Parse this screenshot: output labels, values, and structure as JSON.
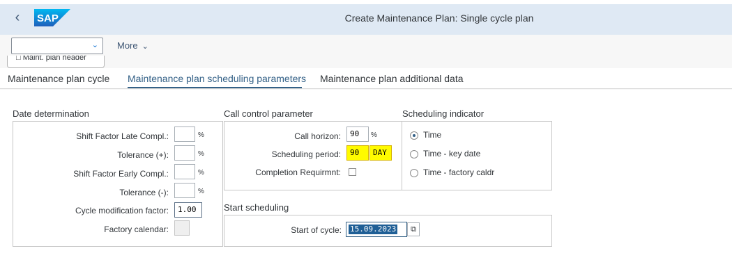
{
  "shell": {
    "back_glyph": "‹",
    "logo_text": "SAP",
    "title": "Create Maintenance Plan: Single cycle plan"
  },
  "toolbar": {
    "dropdown_value": "",
    "more_label": "More",
    "header_button_label": "Maint. plan header"
  },
  "tabs": [
    {
      "label": "Maintenance plan cycle",
      "active": false
    },
    {
      "label": "Maintenance plan scheduling parameters",
      "active": true
    },
    {
      "label": "Maintenance plan additional data",
      "active": false
    }
  ],
  "date_determination": {
    "title": "Date determination",
    "fields": [
      {
        "label": "Shift Factor Late Compl.:",
        "value": "",
        "unit": "%"
      },
      {
        "label": "Tolerance (+):",
        "value": "",
        "unit": "%"
      },
      {
        "label": "Shift Factor Early Compl.:",
        "value": "",
        "unit": "%"
      },
      {
        "label": "Tolerance (-):",
        "value": "",
        "unit": "%"
      },
      {
        "label": "Cycle modification factor:",
        "value": "1.00"
      },
      {
        "label": "Factory calendar:",
        "value": ""
      }
    ]
  },
  "call_control": {
    "title": "Call control parameter",
    "call_horizon_label": "Call horizon:",
    "call_horizon_value": "90",
    "call_horizon_unit": "%",
    "scheduling_period_label": "Scheduling period:",
    "scheduling_period_value": "90",
    "scheduling_period_unit": "DAY",
    "completion_label": "Completion Requirmnt:",
    "completion_checked": false
  },
  "scheduling_indicator": {
    "title": "Scheduling indicator",
    "options": [
      {
        "label": "Time",
        "selected": true
      },
      {
        "label": "Time - key date",
        "selected": false
      },
      {
        "label": "Time - factory caldr",
        "selected": false
      }
    ]
  },
  "start_scheduling": {
    "title": "Start scheduling",
    "start_label": "Start of cycle:",
    "start_value": "15.09.2023"
  },
  "colors": {
    "shell_bg": "#dfe9f4",
    "accent": "#346187",
    "highlight": "#fffb00",
    "selection": "#1f5f96"
  }
}
